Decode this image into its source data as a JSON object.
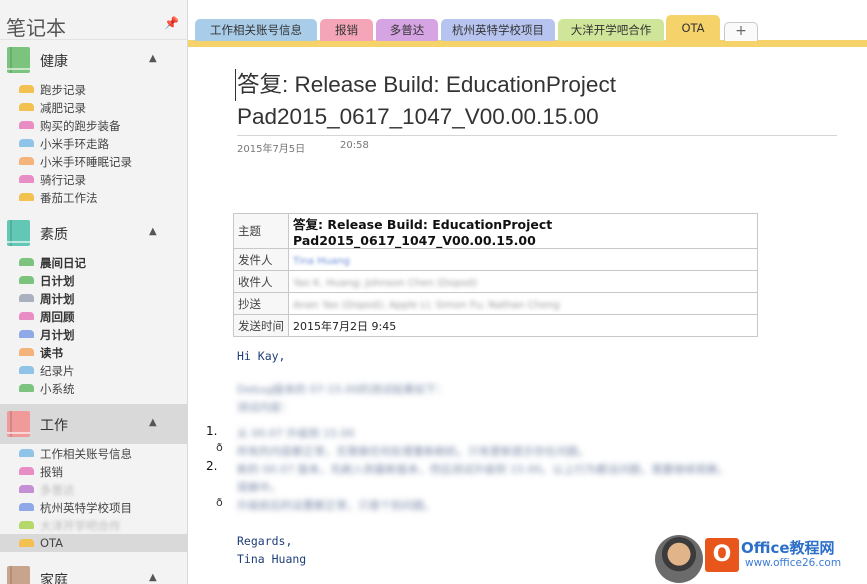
{
  "sidebar": {
    "title": "笔记本",
    "sections": [
      {
        "label": "健康",
        "color": "#7cc47e",
        "active": false,
        "items": [
          {
            "label": "跑步记录",
            "color": "#f3c150",
            "bold": false
          },
          {
            "label": "减肥记录",
            "color": "#f3c150",
            "bold": false
          },
          {
            "label": "购买的跑步装备",
            "color": "#e98ec4",
            "bold": false
          },
          {
            "label": "小米手环走路",
            "color": "#8fc3e8",
            "bold": false
          },
          {
            "label": "小米手环睡眠记录",
            "color": "#f3b37a",
            "bold": false
          },
          {
            "label": "骑行记录",
            "color": "#e98ec4",
            "bold": false
          },
          {
            "label": "番茄工作法",
            "color": "#f3c150",
            "bold": false
          }
        ]
      },
      {
        "label": "素质",
        "color": "#62c7b5",
        "active": false,
        "items": [
          {
            "label": "晨间日记",
            "color": "#7cc47e",
            "bold": true
          },
          {
            "label": "日计划",
            "color": "#7cc47e",
            "bold": true
          },
          {
            "label": "周计划",
            "color": "#a9b0bf",
            "bold": true
          },
          {
            "label": "周回顾",
            "color": "#e98ec4",
            "bold": true
          },
          {
            "label": "月计划",
            "color": "#8fa8e8",
            "bold": true
          },
          {
            "label": "读书",
            "color": "#f3b37a",
            "bold": true
          },
          {
            "label": "纪录片",
            "color": "#8fc3e8",
            "bold": false
          },
          {
            "label": "小系统",
            "color": "#7cc47e",
            "bold": false
          }
        ]
      },
      {
        "label": "工作",
        "color": "#f09a9a",
        "active": true,
        "items": [
          {
            "label": "工作相关账号信息",
            "color": "#8fc3e8",
            "bold": false,
            "blur": false
          },
          {
            "label": "报销",
            "color": "#e98ec4",
            "bold": false,
            "blur": false
          },
          {
            "label": "多普达",
            "color": "#c58fd6",
            "bold": false,
            "blur": true
          },
          {
            "label": "杭州英特学校项目",
            "color": "#8fa8e8",
            "bold": false,
            "blur": false
          },
          {
            "label": "大洋开学吧合作",
            "color": "#b5d86a",
            "bold": false,
            "blur": true
          },
          {
            "label": "OTA",
            "color": "#f3c150",
            "bold": false,
            "active": true
          }
        ]
      },
      {
        "label": "家庭",
        "color": "#c9a48c",
        "active": false,
        "items": []
      }
    ]
  },
  "tabs": [
    {
      "label": "工作相关账号信息",
      "color": "#a9cde9",
      "active": false
    },
    {
      "label": "报销",
      "color": "#f4a6b8",
      "active": false
    },
    {
      "label": "多普达",
      "color": "#d6a3e3",
      "active": false
    },
    {
      "label": "杭州英特学校项目",
      "color": "#b7c4ef",
      "active": false
    },
    {
      "label": "大洋开学吧合作",
      "color": "#cfe69a",
      "active": false
    },
    {
      "label": "OTA",
      "color": "#f5d26a",
      "active": true
    }
  ],
  "tab_add_label": "+",
  "page": {
    "title": "答复: Release Build: EducationProject Pad2015_0617_1047_V00.00.15.00",
    "date": "2015年7月5日",
    "time": "20:58",
    "mail": {
      "subject_key": "主题",
      "subject_value": "答复: Release Build: EducationProject Pad2015_0617_1047_V00.00.15.00",
      "from_key": "发件人",
      "from_value": "Tina Huang",
      "to_key": "收件人",
      "to_value": "Yao K. Huang; Johnson Chen (Dopod)",
      "cc_key": "抄送",
      "cc_value": "Anan Yao (Dopod); Apple Li; Simon Fu; Nathan Cheng",
      "sent_key": "发送时间",
      "sent_value": "2015年7月2日 9:45"
    },
    "greeting": "Hi Kay,",
    "body_line1": "Debug版本的 07-15.00的测试结果如下：",
    "body_line2": "测试内容：",
    "list_num1": "1.",
    "list_line1": "从 00.07 升级到 15.00",
    "bullet1": "ð",
    "bullet1_line": "所有的内容都正常，无需做任何处理重新刷机，只有更新提示存在问题。",
    "list_num2": "2.",
    "list_line2": "新的 00.07 版本，先刷入到最新版本，然后测试升级到 15.00。以上行为都没问题，需要继续观察。",
    "list_line2b": "观察中。",
    "bullet2": "ð",
    "bullet2_line": "升级前后的设置都正常，只是个别问题。",
    "regards": "Regards,",
    "signature": "Tina Huang"
  },
  "watermark": {
    "brand": "Office教程网",
    "url": "www.office26.com",
    "logo_letter": "O"
  }
}
